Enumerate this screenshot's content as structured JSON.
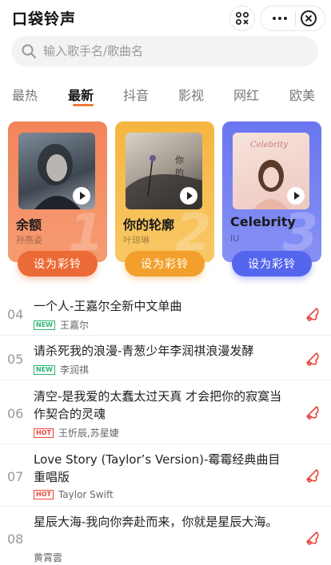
{
  "header": {
    "title": "口袋铃声"
  },
  "search": {
    "placeholder": "输入歌手名/歌曲名"
  },
  "tabs": [
    {
      "label": "最热"
    },
    {
      "label": "最新"
    },
    {
      "label": "抖音"
    },
    {
      "label": "影视"
    },
    {
      "label": "网红"
    },
    {
      "label": "欧美"
    }
  ],
  "active_tab": "最新",
  "cards": [
    {
      "song": "余额",
      "singer": "孙燕姿",
      "rank": "1",
      "button": "设为彩铃",
      "bg": "#f47f4f",
      "btn_color": "#ec6a35"
    },
    {
      "song": "你的轮廓",
      "singer": "叶琼琳",
      "rank": "2",
      "button": "设为彩铃",
      "bg": "#f6ba4a",
      "btn_color": "#f2a02b"
    },
    {
      "song": "Celebrity",
      "singer": "IU",
      "rank": "3",
      "button": "设为彩铃",
      "bg": "#6f7bf2",
      "btn_color": "#5566ee"
    }
  ],
  "songs": [
    {
      "num": "04",
      "title": "一个人-王嘉尔全新中文单曲",
      "tag": "NEW",
      "artist": "王嘉尔"
    },
    {
      "num": "05",
      "title": "请杀死我的浪漫-青葱少年李润祺浪漫发酵",
      "tag": "NEW",
      "artist": "李润祺"
    },
    {
      "num": "06",
      "title": "清空-是我爱的太蠢太过天真 才会把你的寂寞当作契合的灵魂",
      "tag": "HOT",
      "artist": "王忻辰,苏星婕"
    },
    {
      "num": "07",
      "title": "Love Story (Taylor’s Version)-霉霉经典曲目重唱版",
      "tag": "HOT",
      "artist": "Taylor Swift"
    },
    {
      "num": "08",
      "title": "星辰大海-我向你奔赴而来，你就是星辰大海。",
      "tag": "",
      "artist": "黄霄雲"
    }
  ],
  "colors": {
    "accent": "#f07b3a",
    "bell": "#e8473b"
  }
}
